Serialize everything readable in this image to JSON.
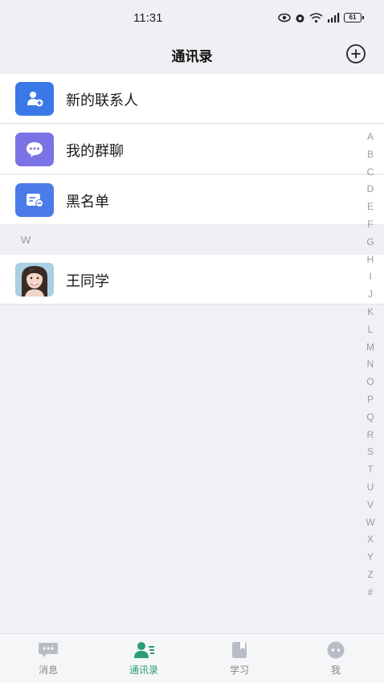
{
  "status_bar": {
    "time": "11:31",
    "battery": "61",
    "icons": [
      "eye-icon",
      "alarm-icon",
      "wifi-icon",
      "signal-icon",
      "battery-icon"
    ]
  },
  "header": {
    "title": "通讯录",
    "add_icon": "plus-circle-icon"
  },
  "contacts_menu": [
    {
      "label": "新的联系人",
      "icon": "add-person-icon",
      "color": "#3b78e7"
    },
    {
      "label": "我的群聊",
      "icon": "chat-bubble-icon",
      "color": "#7b72e6"
    },
    {
      "label": "黑名单",
      "icon": "blocklist-icon",
      "color": "#4a7be8"
    }
  ],
  "section": {
    "letter": "W"
  },
  "contacts": [
    {
      "name": "王同学"
    }
  ],
  "index_letters": [
    "A",
    "B",
    "C",
    "D",
    "E",
    "F",
    "G",
    "H",
    "I",
    "J",
    "K",
    "L",
    "M",
    "N",
    "O",
    "P",
    "Q",
    "R",
    "S",
    "T",
    "U",
    "V",
    "W",
    "X",
    "Y",
    "Z",
    "#"
  ],
  "tabs": [
    {
      "label": "消息",
      "icon": "message-icon",
      "active": false
    },
    {
      "label": "通讯录",
      "icon": "contacts-icon",
      "active": true
    },
    {
      "label": "学习",
      "icon": "book-icon",
      "active": false
    },
    {
      "label": "我",
      "icon": "profile-icon",
      "active": false
    }
  ],
  "colors": {
    "accent": "#2a9d74",
    "inactive": "#888888",
    "background": "#f0f1f5"
  }
}
